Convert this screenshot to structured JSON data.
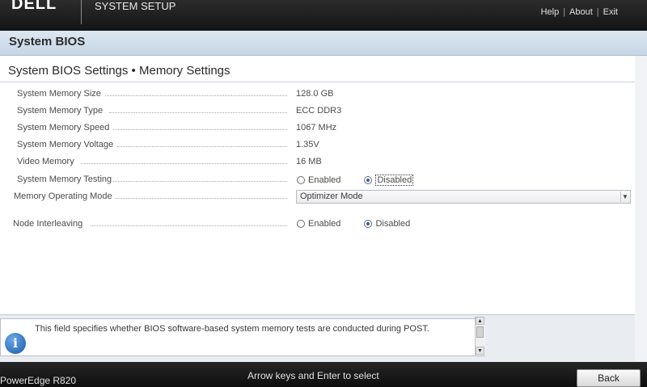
{
  "header": {
    "logo": "DELL",
    "app_title": "SYSTEM SETUP",
    "links": {
      "help": "Help",
      "about": "About",
      "exit": "Exit",
      "separator": "|"
    }
  },
  "section": {
    "title": "System BIOS"
  },
  "page": {
    "heading": "System BIOS Settings • Memory Settings",
    "info_rows": [
      {
        "label": "System Memory Size",
        "value": "128.0 GB"
      },
      {
        "label": "System Memory Type",
        "value": "ECC DDR3"
      },
      {
        "label": "System Memory Speed",
        "value": "1067 MHz"
      },
      {
        "label": "System Memory Voltage",
        "value": "1.35V"
      },
      {
        "label": "Video Memory",
        "value": "16 MB"
      }
    ],
    "memory_testing": {
      "label": "System Memory Testing",
      "options": [
        "Enabled",
        "Disabled"
      ],
      "selected": "Disabled"
    },
    "operating_mode": {
      "label": "Memory Operating Mode",
      "value": "Optimizer Mode"
    },
    "node_interleaving": {
      "label": "Node Interleaving",
      "options": [
        "Enabled",
        "Disabled"
      ],
      "selected": "Disabled"
    }
  },
  "help": {
    "icon": "info-icon",
    "icon_glyph": "i",
    "text": "This field specifies whether BIOS software-based system memory tests are conducted during POST."
  },
  "footer": {
    "model": "PowerEdge R820",
    "hint": "Arrow keys and Enter to select",
    "back_label": "Back"
  },
  "colors": {
    "header_bg": "#1c1c1c",
    "section_bg": "#d4e0ec",
    "radio_selected": "#1f5fb4",
    "info_icon": "#2a6cc0"
  }
}
